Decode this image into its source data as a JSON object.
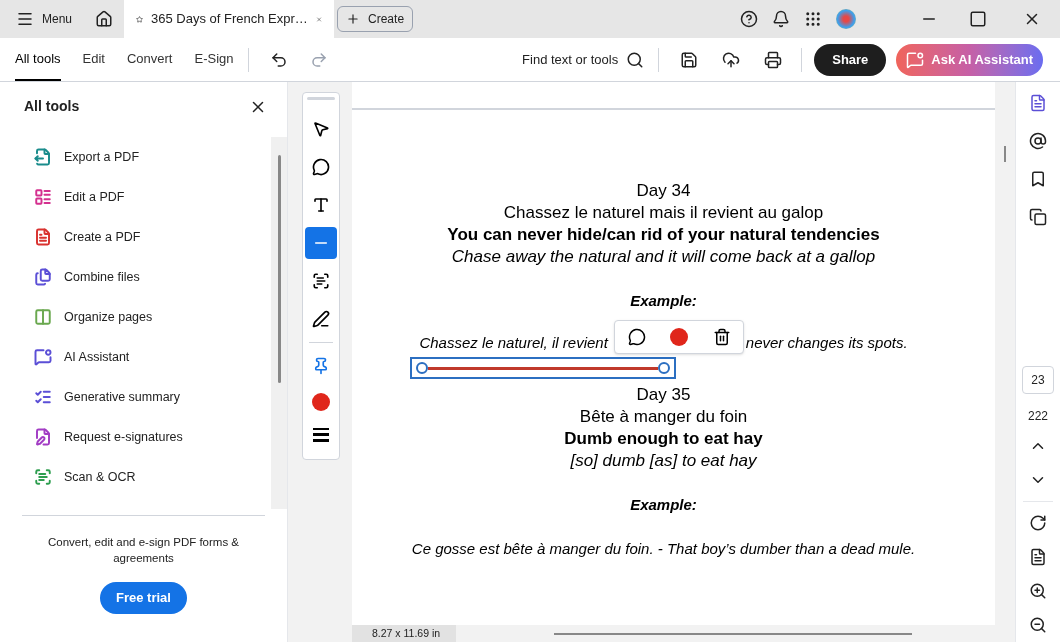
{
  "top_bar": {
    "menu": "Menu",
    "tab": {
      "title": "365 Days of French Expr…",
      "selected": true
    },
    "create": "Create"
  },
  "toolbar": {
    "tabs": [
      {
        "label": "All tools",
        "selected": true
      },
      {
        "label": "Edit",
        "selected": false
      },
      {
        "label": "Convert",
        "selected": false
      },
      {
        "label": "E-Sign",
        "selected": false
      }
    ],
    "find": "Find text or tools",
    "share": "Share",
    "ai": "Ask AI Assistant"
  },
  "tools_panel": {
    "title": "All tools",
    "items": [
      {
        "kind": "export",
        "label": "Export a PDF",
        "color": "#1a8c8c"
      },
      {
        "kind": "edit",
        "label": "Edit a PDF",
        "color": "#d4308f"
      },
      {
        "kind": "create",
        "label": "Create a PDF",
        "color": "#d9322f"
      },
      {
        "kind": "combine",
        "label": "Combine files",
        "color": "#5b4fd6"
      },
      {
        "kind": "organize",
        "label": "Organize pages",
        "color": "#6aa84f"
      },
      {
        "kind": "ai",
        "label": "AI Assistant",
        "color": "#5b4fd6"
      },
      {
        "kind": "summary",
        "label": "Generative summary",
        "color": "#5b4fd6"
      },
      {
        "kind": "sign",
        "label": "Request e-signatures",
        "color": "#a23cc4"
      },
      {
        "kind": "scan",
        "label": "Scan & OCR",
        "color": "#2e9e4f"
      }
    ],
    "footer_text": "Convert, edit and e-sign PDF forms & agreements",
    "free_trial": "Free trial"
  },
  "annotation_tools": [
    {
      "kind": "select",
      "selected": false
    },
    {
      "kind": "comment",
      "selected": false
    },
    {
      "kind": "text",
      "selected": false
    },
    {
      "kind": "line",
      "selected": true
    },
    {
      "kind": "textbox",
      "selected": false
    },
    {
      "kind": "draw",
      "selected": false
    },
    {
      "kind": "divider"
    },
    {
      "kind": "pin",
      "selected": false
    },
    {
      "kind": "color",
      "color": "#e0261b"
    },
    {
      "kind": "weight",
      "selected": false
    }
  ],
  "document": {
    "entries": [
      {
        "day": "Day 34",
        "french": "Chassez le naturel mais il revient au galop",
        "english": "You can never hide/can rid of your natural tendencies",
        "literal": "Chase away the natural and it will come back at a gallop",
        "example_label": "Example:",
        "example_parts": [
          "Chassez le naturel, il revient",
          "never changes its spots."
        ],
        "annotated": true
      },
      {
        "day": "Day 35",
        "french": "Bête à manger du foin",
        "english": "Dumb enough to eat hay",
        "literal": "[so] dumb [as] to eat hay",
        "example_label": "Example:",
        "example_parts": [
          "Ce gosse est bête à manger du foin. - That boy’s dumber than a dead mule."
        ],
        "annotated": false
      }
    ],
    "line_popup": {
      "color": "#e0261b"
    }
  },
  "page_nav": {
    "current": "23",
    "total": "222"
  },
  "status": {
    "size": "8.27 x 11.69 in"
  }
}
